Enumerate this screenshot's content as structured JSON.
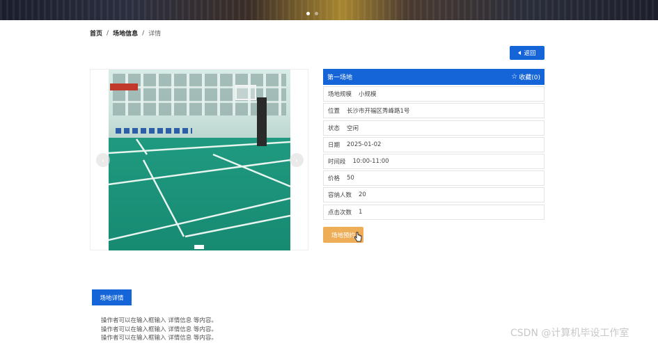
{
  "breadcrumb": {
    "home": "首页",
    "section": "场地信息",
    "current": "详情",
    "separator": "/"
  },
  "banner": {
    "slide_count": 2,
    "active_slide": 1
  },
  "back_button": {
    "label": "返回"
  },
  "carousel": {
    "active_index": 1
  },
  "venue": {
    "name": "第一场地",
    "favorite_label": "收藏(0)",
    "fields": [
      {
        "key": "场地规模",
        "value": "小规模"
      },
      {
        "key": "位置",
        "value": "长沙市开福区秀峰路1号"
      },
      {
        "key": "状态",
        "value": "空闲"
      },
      {
        "key": "日期",
        "value": "2025-01-02"
      },
      {
        "key": "时间段",
        "value": "10:00-11:00"
      },
      {
        "key": "价格",
        "value": "50"
      },
      {
        "key": "容纳人数",
        "value": "20"
      },
      {
        "key": "点击次数",
        "value": "1"
      }
    ]
  },
  "book_button": {
    "label": "场地预约"
  },
  "details_tab": {
    "label": "场地详情"
  },
  "description_lines": [
    "操作者可以在输入框输入  详情信息  等内容。",
    "操作者可以在输入框输入  详情信息  等内容。",
    "操作者可以在输入框输入  详情信息  等内容。"
  ],
  "watermark": "CSDN @计算机毕设工作室",
  "colors": {
    "primary": "#1565d8",
    "book": "#eeae58",
    "court": "#1d8f76"
  }
}
